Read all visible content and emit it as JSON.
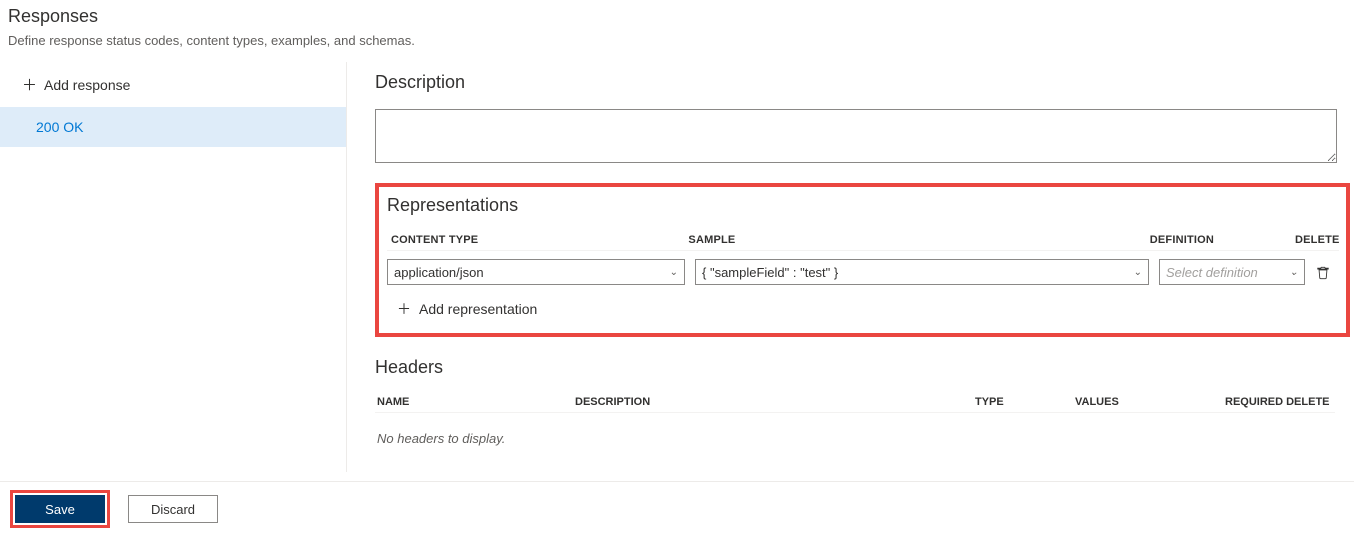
{
  "header": {
    "title": "Responses",
    "subtitle": "Define response status codes, content types, examples, and schemas."
  },
  "sidebar": {
    "add_response_label": "Add response",
    "responses": [
      {
        "label": "200 OK",
        "selected": true
      }
    ]
  },
  "description_section": {
    "title": "Description",
    "value": ""
  },
  "representations_section": {
    "title": "Representations",
    "columns": {
      "content_type": "CONTENT TYPE",
      "sample": "SAMPLE",
      "definition": "DEFINITION",
      "delete": "DELETE"
    },
    "rows": [
      {
        "content_type": "application/json",
        "sample": "{ \"sampleField\" : \"test\" }",
        "definition_placeholder": "Select definition",
        "definition_value": ""
      }
    ],
    "add_representation_label": "Add representation"
  },
  "headers_section": {
    "title": "Headers",
    "columns": {
      "name": "NAME",
      "description": "DESCRIPTION",
      "type": "TYPE",
      "values": "VALUES",
      "required_delete": "REQUIRED DELETE"
    },
    "empty_message": "No headers to display."
  },
  "footer": {
    "save_label": "Save",
    "discard_label": "Discard"
  }
}
